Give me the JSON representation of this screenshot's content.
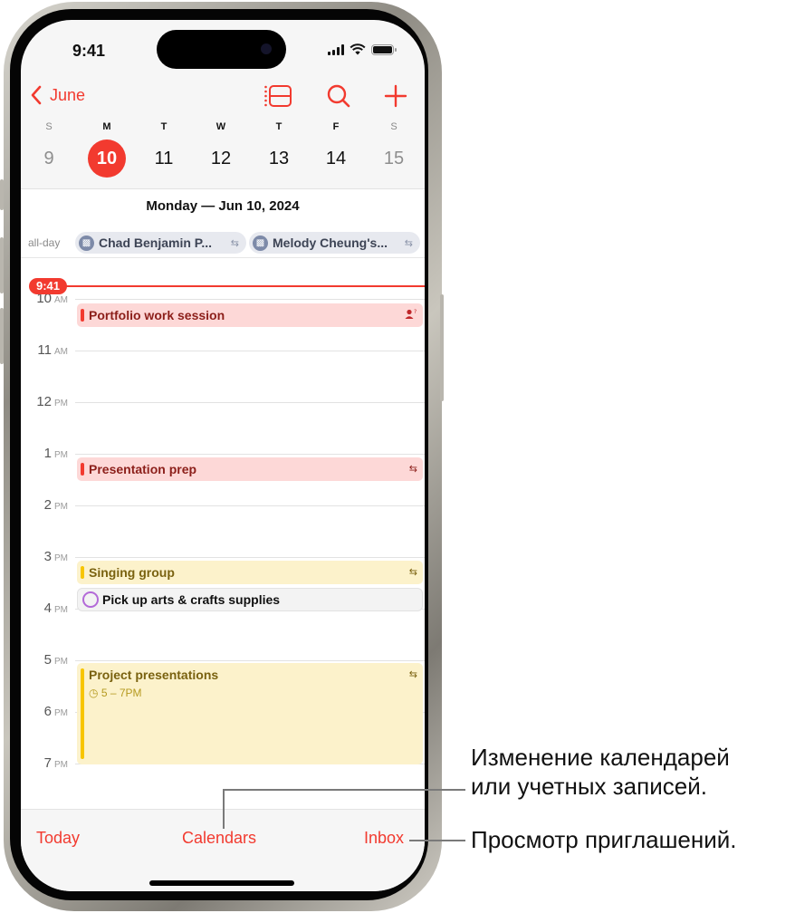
{
  "status_bar": {
    "time": "9:41"
  },
  "nav": {
    "back_label": "June",
    "icons": [
      "list-view-icon",
      "search-icon",
      "add-icon"
    ]
  },
  "week": {
    "days": [
      {
        "letter": "S",
        "num": "9",
        "weekend": true
      },
      {
        "letter": "M",
        "num": "10",
        "selected": true
      },
      {
        "letter": "T",
        "num": "11"
      },
      {
        "letter": "W",
        "num": "12"
      },
      {
        "letter": "T",
        "num": "13"
      },
      {
        "letter": "F",
        "num": "14"
      },
      {
        "letter": "S",
        "num": "15",
        "weekend": true
      }
    ]
  },
  "day_view": {
    "date_title": "Monday — Jun 10, 2024",
    "all_day_label": "all-day",
    "all_day_events": [
      {
        "title": "Chad Benjamin P...",
        "icon": "gift-icon",
        "repeat": true
      },
      {
        "title": "Melody Cheung's...",
        "icon": "gift-icon",
        "repeat": true
      }
    ],
    "current_time": "9:41",
    "hours": [
      {
        "h": "10",
        "p": "AM"
      },
      {
        "h": "11",
        "p": "AM"
      },
      {
        "h": "12",
        "p": "PM"
      },
      {
        "h": "1",
        "p": "PM"
      },
      {
        "h": "2",
        "p": "PM"
      },
      {
        "h": "3",
        "p": "PM"
      },
      {
        "h": "4",
        "p": "PM"
      },
      {
        "h": "5",
        "p": "PM"
      },
      {
        "h": "6",
        "p": "PM"
      },
      {
        "h": "7",
        "p": "PM"
      }
    ],
    "events": [
      {
        "title": "Portfolio work session",
        "color": "red",
        "icon": "invitee-pending-icon"
      },
      {
        "title": "Presentation prep",
        "color": "red",
        "icon": "repeat-icon"
      },
      {
        "title": "Singing group",
        "color": "yellow",
        "icon": "repeat-icon"
      },
      {
        "title": "Project presentations",
        "color": "yellow",
        "icon": "repeat-icon",
        "time": "5 – 7PM"
      }
    ],
    "reminder": {
      "title": "Pick up arts & crafts supplies"
    }
  },
  "tabbar": {
    "today": "Today",
    "calendars": "Calendars",
    "inbox": "Inbox"
  },
  "callouts": {
    "calendars": "Изменение календарей\nили учетных записей.",
    "inbox": "Просмотр приглашений."
  },
  "colors": {
    "accent": "#f23a2f",
    "event_red_bg": "#fdd8d7",
    "event_yellow_bg": "#fcf2cb",
    "reminder_ring": "#b36ad8"
  }
}
